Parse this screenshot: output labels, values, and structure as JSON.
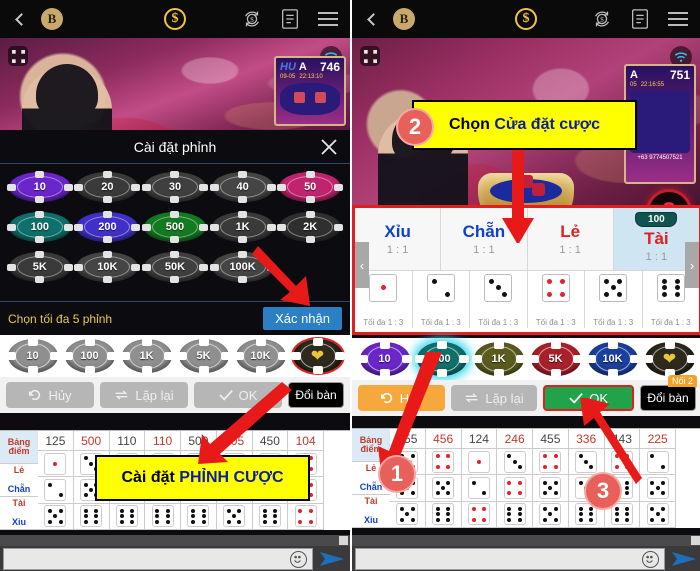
{
  "topbar": {
    "back_icon": "chevron-left-icon",
    "balance_badge": "B",
    "coin_symbol": "$",
    "refresh_money_icon": "refresh-money-icon",
    "history_icon": "history-document-icon",
    "menu_icon": "hamburger-menu-icon"
  },
  "left": {
    "video": {
      "fullscreen_icon": "fullscreen-icon",
      "wifi_icon": "wifi-icon",
      "scoreboard": {
        "brand": "HU",
        "label": "A",
        "number": "746",
        "date": "09-05",
        "time": "22:13:10"
      }
    },
    "dialog": {
      "title": "Cài đặt phỉnh",
      "close_icon": "close-icon",
      "note": "Chọn tối đa 5 phỉnh",
      "confirm": "Xác nhận",
      "chips": [
        {
          "label": "10",
          "color": "#6a26c9",
          "active": true
        },
        {
          "label": "20",
          "color": "#3a3a3a",
          "active": false
        },
        {
          "label": "30",
          "color": "#3f3f3f",
          "active": false
        },
        {
          "label": "40",
          "color": "#454545",
          "active": false
        },
        {
          "label": "50",
          "color": "#c1246e",
          "active": true
        },
        {
          "label": "100",
          "color": "#0f6f6a",
          "active": true
        },
        {
          "label": "200",
          "color": "#4030c8",
          "active": true
        },
        {
          "label": "500",
          "color": "#147a22",
          "active": true
        },
        {
          "label": "1K",
          "color": "#3a3a3a",
          "active": false
        },
        {
          "label": "2K",
          "color": "#2f2f2f",
          "active": false
        },
        {
          "label": "5K",
          "color": "#3a3a3a",
          "active": false
        },
        {
          "label": "10K",
          "color": "#454545",
          "active": false
        },
        {
          "label": "50K",
          "color": "#3f3f3f",
          "active": false
        },
        {
          "label": "100K",
          "color": "#454545",
          "active": false
        }
      ]
    },
    "chipbar": [
      {
        "label": "10",
        "color": "#8f8f8f"
      },
      {
        "label": "100",
        "color": "#8f8f8f"
      },
      {
        "label": "1K",
        "color": "#8f8f8f"
      },
      {
        "label": "5K",
        "color": "#8f8f8f"
      },
      {
        "label": "10K",
        "color": "#8f8f8f"
      },
      {
        "label": "",
        "color": "#2d2a1d"
      }
    ],
    "actions": {
      "cancel": "Hủy",
      "repeat": "Lặp lại",
      "ok": "OK",
      "change_table": "Đổi bàn"
    },
    "scoretable": {
      "row_labels": [
        "Bảng điểm",
        "Lẻ Chẵn",
        "Tài Xỉu"
      ],
      "numbers": [
        "125",
        "500",
        "110",
        "110",
        "500",
        "505",
        "450",
        "104"
      ]
    },
    "callout": {
      "text_plain": "Cài đặt ",
      "text_blue": "PHỈNH CƯỢC"
    }
  },
  "right": {
    "video": {
      "fullscreen_icon": "fullscreen-icon",
      "wifi_icon": "wifi-icon",
      "countdown": "8",
      "scoreboard": {
        "label": "A",
        "number": "751",
        "date": "05",
        "time": "22:16:55",
        "phone": "+63 9774507521"
      }
    },
    "callout": {
      "step": "2",
      "text_plain": "Chọn ",
      "text_blue": "Cửa đặt cược"
    },
    "betting": {
      "options": [
        {
          "name": "Xỉu",
          "odds": "1 : 1",
          "color": "#1042c8",
          "selected": false,
          "bet": ""
        },
        {
          "name": "Chẵn",
          "odds": "1 : 1",
          "color": "#1042c8",
          "selected": false,
          "bet": ""
        },
        {
          "name": "Lẻ",
          "odds": "1 : 1",
          "color": "#e02020",
          "selected": false,
          "bet": ""
        },
        {
          "name": "Tài",
          "odds": "1 : 1",
          "color": "#e02020",
          "selected": true,
          "bet": "100"
        }
      ],
      "dice_row": [
        {
          "pips": 1,
          "max": "Tối đa 1 : 3",
          "red": true
        },
        {
          "pips": 2,
          "max": "Tối đa 1 : 3",
          "red": false
        },
        {
          "pips": 3,
          "max": "Tối đa 1 : 3",
          "red": false
        },
        {
          "pips": 4,
          "max": "Tối đa 1 : 3",
          "red": true
        },
        {
          "pips": 5,
          "max": "Tối đa 1 : 3",
          "red": false
        },
        {
          "pips": 6,
          "max": "Tối đa 1 : 3",
          "red": false
        }
      ],
      "prev_arrow": "‹",
      "next_arrow": "›"
    },
    "chipbar": [
      {
        "label": "10",
        "color": "#6a26c9",
        "selected": false
      },
      {
        "label": "100",
        "color": "#0f6f6a",
        "selected": true
      },
      {
        "label": "1K",
        "color": "#5a5a1e",
        "selected": false
      },
      {
        "label": "5K",
        "color": "#a8202a",
        "selected": false
      },
      {
        "label": "10K",
        "color": "#1a3f9c",
        "selected": false
      },
      {
        "label": "",
        "color": "#2d2a1d",
        "selected": false
      }
    ],
    "actions": {
      "cancel": "Hủy",
      "repeat": "Lặp lại",
      "ok": "OK",
      "change_table": "Đổi bàn",
      "noi_badge": "Nối 2"
    },
    "scoretable": {
      "row_labels": [
        "Bảng điểm",
        "Lẻ Chẵn",
        "Tài Xỉu"
      ],
      "numbers": [
        "555",
        "456",
        "124",
        "246",
        "455",
        "336",
        "443",
        "225"
      ]
    },
    "steps": {
      "one": "1",
      "three": "3"
    }
  },
  "chat": {
    "smiley_icon": "smiley-icon",
    "send_icon": "send-icon",
    "placeholder": ""
  },
  "colors": {
    "accent_red": "#e02020",
    "callout_yellow": "#ffff00",
    "blue_text": "#0b1f9e",
    "green_ok": "#21a349",
    "orange": "#f7a83c"
  }
}
